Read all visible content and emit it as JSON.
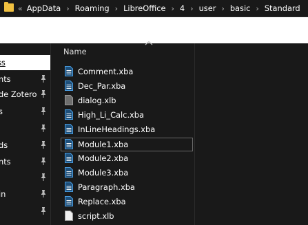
{
  "addressbar": {
    "lead_chevron": "«",
    "separator": "›",
    "crumbs": [
      "AppData",
      "Roaming",
      "LibreOffice",
      "4",
      "user",
      "basic",
      "Standard"
    ]
  },
  "nav": {
    "items": [
      {
        "label": "ss",
        "selected": true,
        "pinned": false
      },
      {
        "label": "nts",
        "pinned": true
      },
      {
        "label": "de Zotero",
        "pinned": true
      },
      {
        "label": "s",
        "pinned": true
      },
      {
        "label": "",
        "pinned": true
      },
      {
        "label": "ds",
        "pinned": true
      },
      {
        "label": "nts",
        "pinned": true
      },
      {
        "label": "",
        "pinned": true
      },
      {
        "label": "in",
        "pinned": true
      },
      {
        "label": "",
        "pinned": true
      }
    ]
  },
  "list": {
    "column_name": "Name",
    "files": [
      {
        "name": "Comment.xba",
        "type": "xba"
      },
      {
        "name": "Dec_Par.xba",
        "type": "xba"
      },
      {
        "name": "dialog.xlb",
        "type": "xlb"
      },
      {
        "name": "High_Li_Calc.xba",
        "type": "xba"
      },
      {
        "name": "InLineHeadings.xba",
        "type": "xba"
      },
      {
        "name": "Module1.xba",
        "type": "xba",
        "selected": true
      },
      {
        "name": "Module2.xba",
        "type": "xba"
      },
      {
        "name": "Module3.xba",
        "type": "xba"
      },
      {
        "name": "Paragraph.xba",
        "type": "xba"
      },
      {
        "name": "Replace.xba",
        "type": "xba"
      },
      {
        "name": "script.xlb",
        "type": "xlb"
      }
    ]
  },
  "colors": {
    "background": "#191919",
    "xba_icon": "#4a9de0",
    "xlb_icon": "#9a9a9a",
    "folder": "#f0c040"
  }
}
